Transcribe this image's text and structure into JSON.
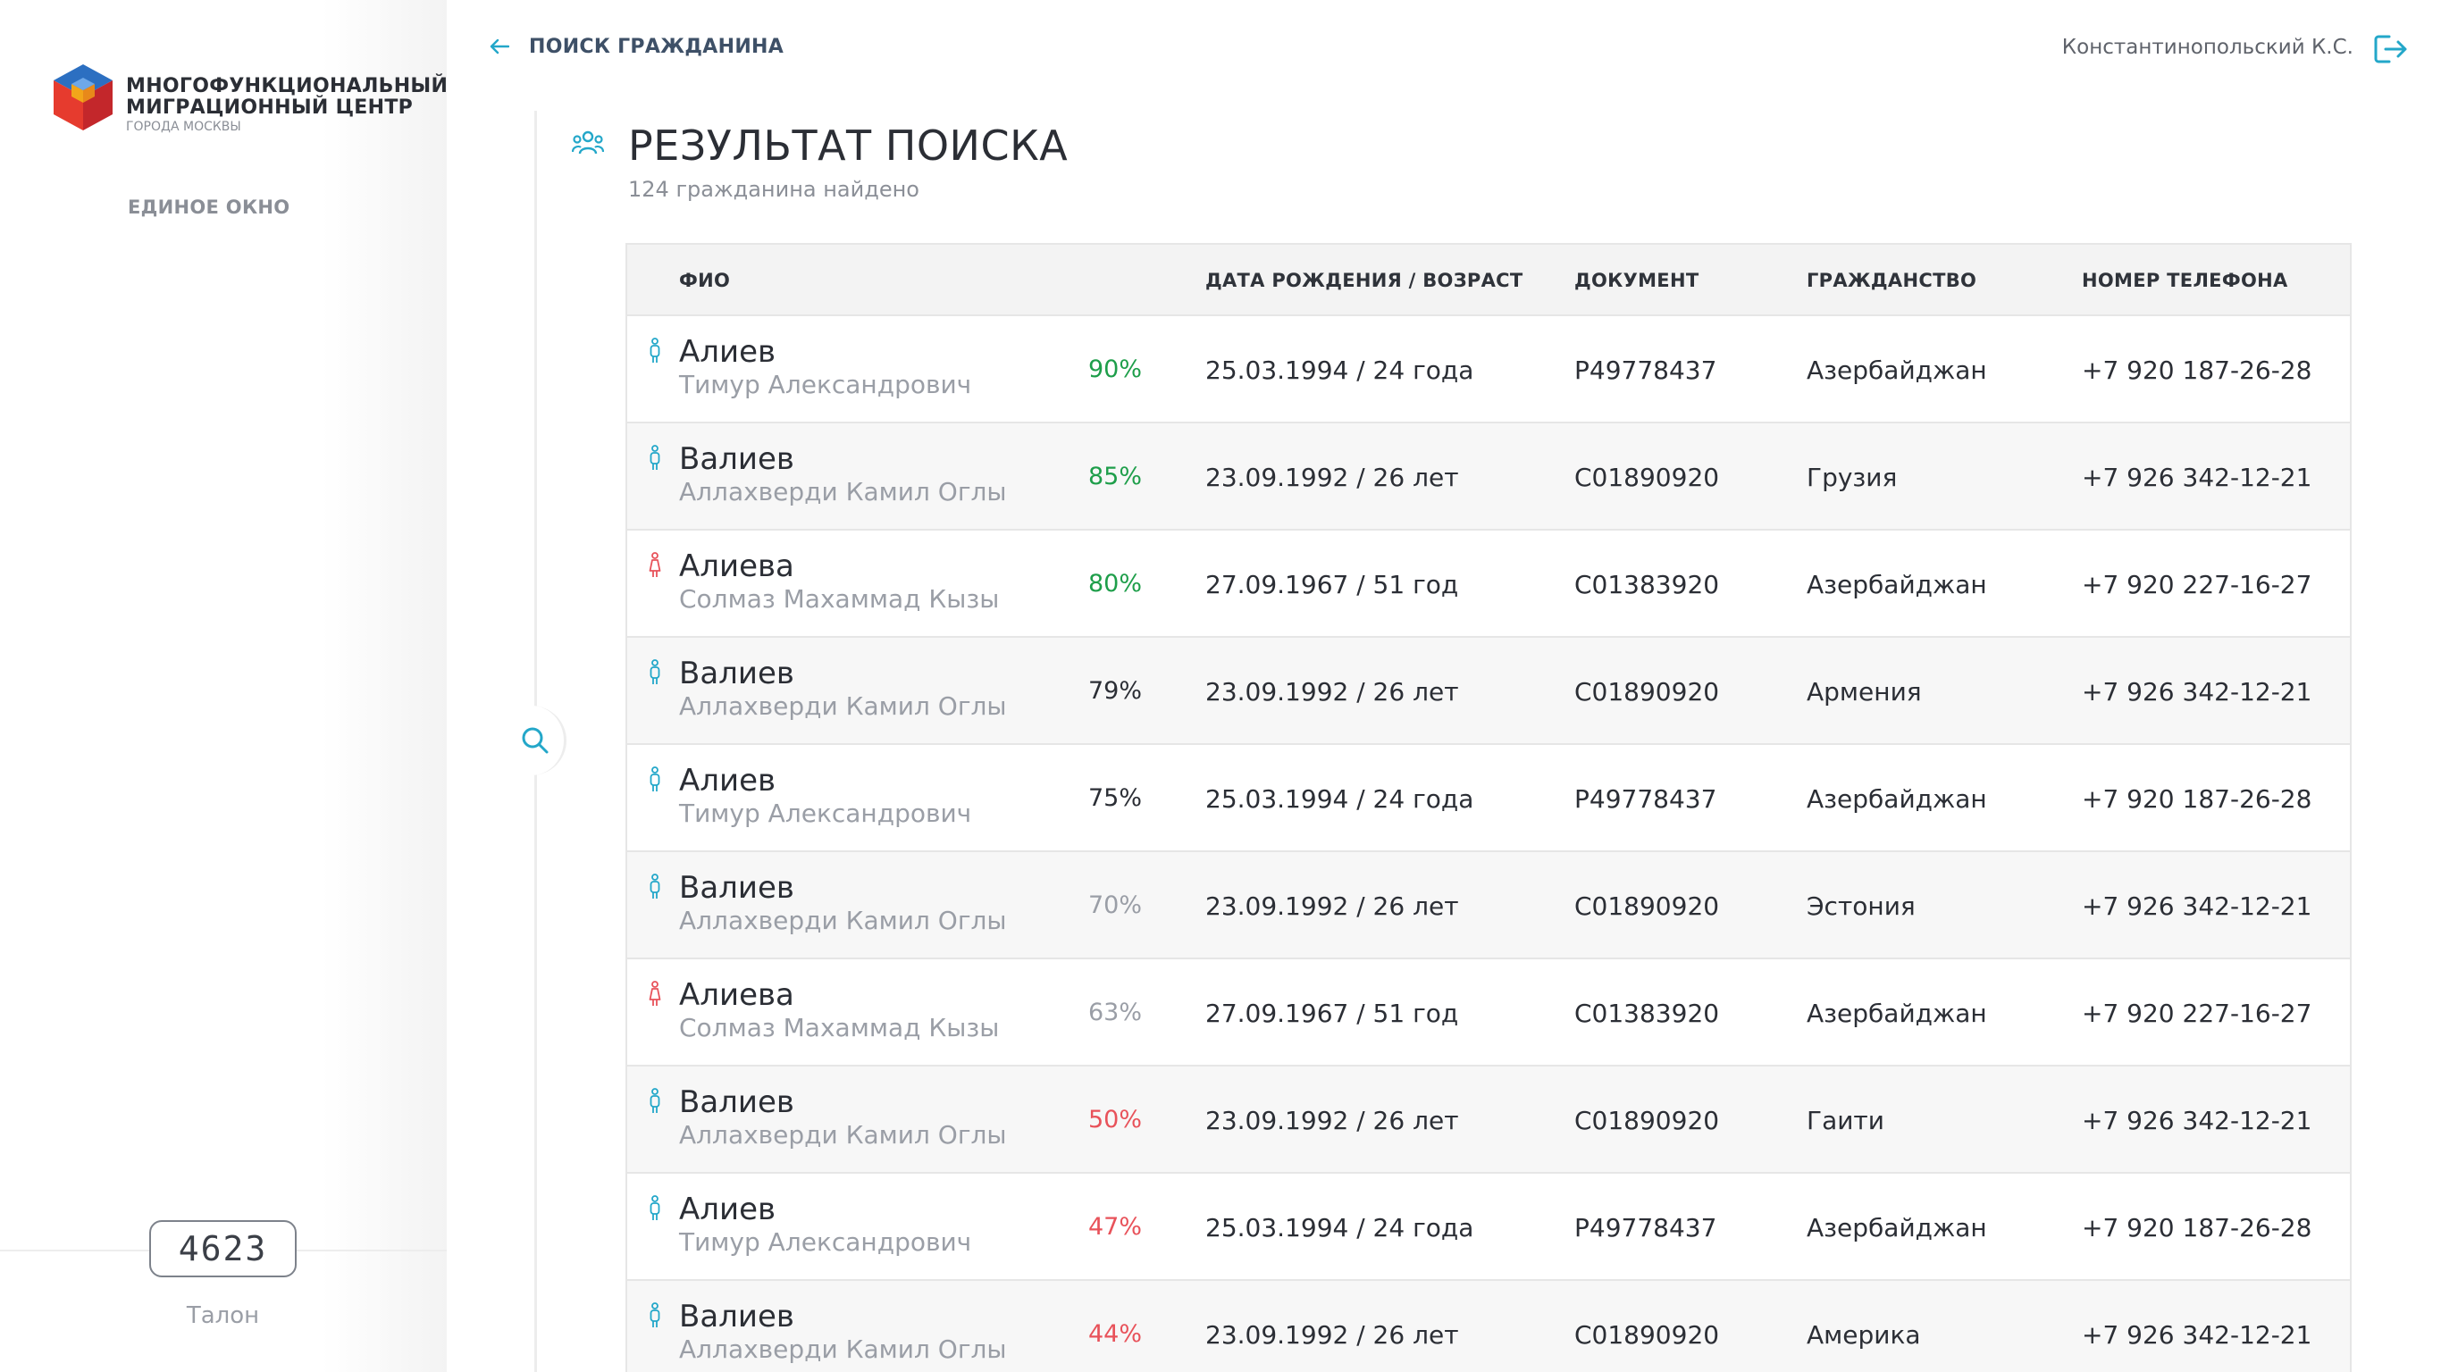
{
  "sidebar": {
    "logo": {
      "line1": "МНОГОФУНКЦИОНАЛЬНЫЙ",
      "line2": "МИГРАЦИОННЫЙ ЦЕНТР",
      "line3": "ГОРОДА МОСКВЫ",
      "colors": [
        "#e63b2e",
        "#2c6fc1",
        "#f2a51a"
      ]
    },
    "nav_item": "ЕДИНОЕ ОКНО",
    "ticket": {
      "number": "4623",
      "label": "Талон"
    }
  },
  "header": {
    "back_icon": "arrow-left-icon",
    "back_label": "ПОИСК ГРАЖДАНИНА",
    "user_name": "Константинопольский К.С.",
    "logout_icon": "logout-icon"
  },
  "results": {
    "icon": "people-icon",
    "title": "РЕЗУЛЬТАТ ПОИСКА",
    "subtitle": "124 гражданина найдено"
  },
  "table": {
    "columns": {
      "name": "ФИО",
      "birth": "ДАТА РОЖДЕНИЯ / ВОЗРАСТ",
      "document": "ДОКУМЕНТ",
      "citizenship": "ГРАЖДАНСТВО",
      "phone": "НОМЕР ТЕЛЕФОНА"
    },
    "rows": [
      {
        "gender": "male",
        "surname": "Алиев",
        "given": "Тимур Александрович",
        "match": "90%",
        "match_level": "high",
        "birth": "25.03.1994  /  24 года",
        "document": "P49778437",
        "citizenship": "Азербайджан",
        "phone": "+7 920 187-26-28"
      },
      {
        "gender": "male",
        "surname": "Валиев",
        "given": "Аллахверди Камил Оглы",
        "match": "85%",
        "match_level": "high",
        "birth": "23.09.1992  /  26 лет",
        "document": "C01890920",
        "citizenship": "Грузия",
        "phone": "+7 926 342-12-21"
      },
      {
        "gender": "female",
        "surname": "Алиева",
        "given": "Солмаз Махаммад Кызы",
        "match": "80%",
        "match_level": "high",
        "birth": "27.09.1967  /  51 год",
        "document": "C01383920",
        "citizenship": "Азербайджан",
        "phone": "+7 920 227-16-27"
      },
      {
        "gender": "male",
        "surname": "Валиев",
        "given": "Аллахверди Камил Оглы",
        "match": "79%",
        "match_level": "medium",
        "birth": "23.09.1992  /  26 лет",
        "document": "C01890920",
        "citizenship": "Армения",
        "phone": "+7 926 342-12-21"
      },
      {
        "gender": "male",
        "surname": "Алиев",
        "given": "Тимур Александрович",
        "match": "75%",
        "match_level": "medium",
        "birth": "25.03.1994  /  24 года",
        "document": "P49778437",
        "citizenship": "Азербайджан",
        "phone": "+7 920 187-26-28"
      },
      {
        "gender": "male",
        "surname": "Валиев",
        "given": "Аллахверди Камил Оглы",
        "match": "70%",
        "match_level": "low",
        "birth": "23.09.1992  /  26 лет",
        "document": "C01890920",
        "citizenship": "Эстония",
        "phone": "+7 926 342-12-21"
      },
      {
        "gender": "female",
        "surname": "Алиева",
        "given": "Солмаз Махаммад Кызы",
        "match": "63%",
        "match_level": "low",
        "birth": "27.09.1967  /  51 год",
        "document": "C01383920",
        "citizenship": "Азербайджан",
        "phone": "+7 920 227-16-27"
      },
      {
        "gender": "male",
        "surname": "Валиев",
        "given": "Аллахверди Камил Оглы",
        "match": "50%",
        "match_level": "poor",
        "birth": "23.09.1992  /  26 лет",
        "document": "C01890920",
        "citizenship": "Гаити",
        "phone": "+7 926 342-12-21"
      },
      {
        "gender": "male",
        "surname": "Алиев",
        "given": "Тимур Александрович",
        "match": "47%",
        "match_level": "poor",
        "birth": "25.03.1994  /  24 года",
        "document": "P49778437",
        "citizenship": "Азербайджан",
        "phone": "+7 920 187-26-28"
      },
      {
        "gender": "male",
        "surname": "Валиев",
        "given": "Аллахверди Камил Оглы",
        "match": "44%",
        "match_level": "poor",
        "birth": "23.09.1992  /  26 лет",
        "document": "C01890920",
        "citizenship": "Америка",
        "phone": "+7 926 342-12-21"
      }
    ]
  },
  "colors": {
    "accent": "#23a7c9",
    "male": "#23a7c9",
    "female": "#e8525a",
    "match_high": "#1e9e4a",
    "match_medium": "#2b2e35",
    "match_low": "#9a9ea6",
    "match_poor": "#e8525a"
  }
}
